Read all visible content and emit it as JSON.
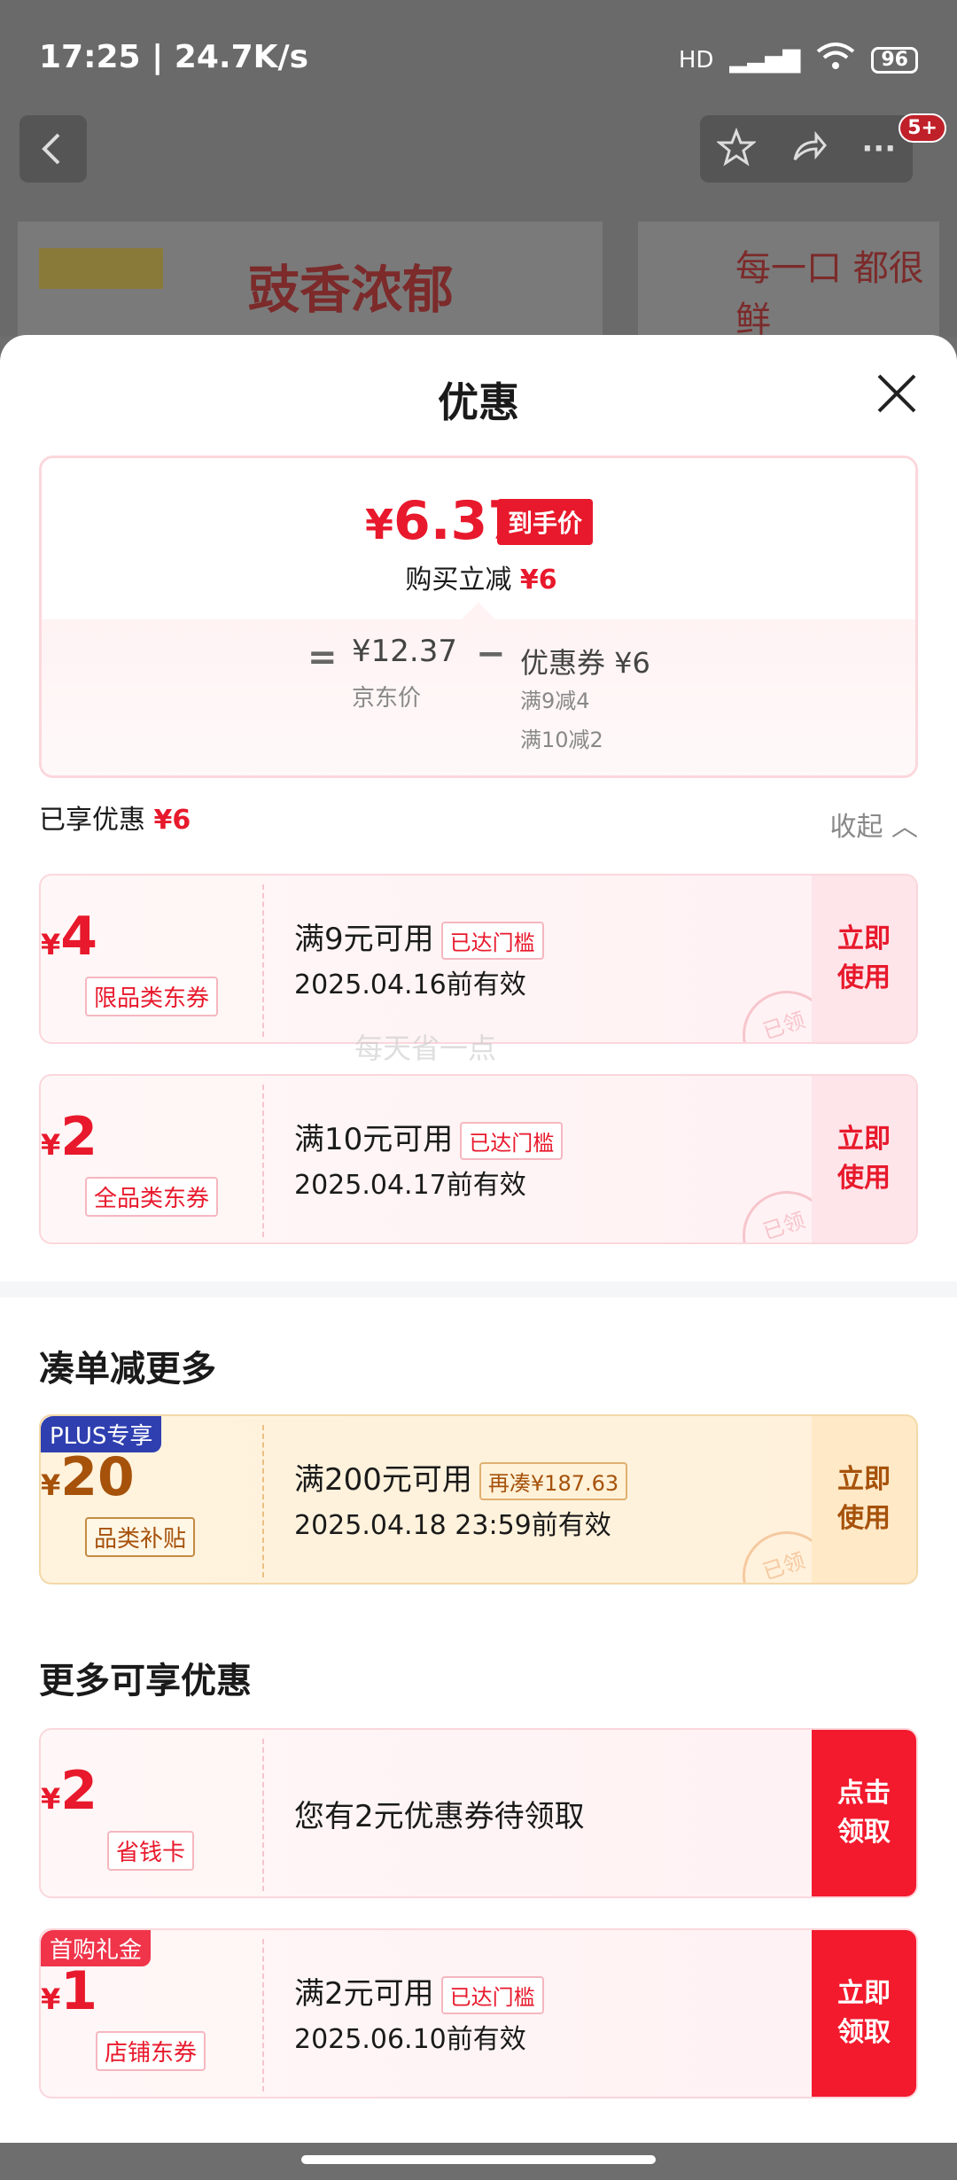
{
  "status_bar": {
    "time_speed": "17:25 | 24.7K/s",
    "network": "HD",
    "battery": "96"
  },
  "background": {
    "badge": "5+",
    "banner_text_1": "豉香浓郁",
    "banner_text_2": "每一口 都很鲜"
  },
  "sheet": {
    "title": "优惠",
    "price": {
      "yen": "¥",
      "final": "6.37",
      "final_tag": "到手价",
      "instant_label": "购买立减",
      "instant_value": "¥6",
      "eq": "=",
      "jd_price": "¥12.37",
      "jd_label": "京东价",
      "minus": "−",
      "coupon_sum": "优惠券 ¥6",
      "coupon_detail_1": "满9减4",
      "coupon_detail_2": "满10减2"
    },
    "enjoyed_label": "已享优惠",
    "enjoyed_value": "¥6",
    "collapse_label": "收起 ︿",
    "coupons": [
      {
        "yen": "¥",
        "amount": "4",
        "type": "限品类东券",
        "condition": "满9元可用",
        "tag": "已达门槛",
        "date": "2025.04.16前有效",
        "action_1": "立即",
        "action_2": "使用",
        "stamp": "已领"
      },
      {
        "yen": "¥",
        "amount": "2",
        "type": "全品类东券",
        "condition": "满10元可用",
        "tag": "已达门槛",
        "date": "2025.04.17前有效",
        "action_1": "立即",
        "action_2": "使用",
        "stamp": "已领"
      }
    ],
    "more_title": "凑单减更多",
    "plus_coupon": {
      "corner": "PLUS专享",
      "yen": "¥",
      "amount": "20",
      "type": "品类补贴",
      "condition": "满200元可用",
      "tag": "再凑¥187.63",
      "date": "2025.04.18 23:59前有效",
      "action_1": "立即",
      "action_2": "使用",
      "stamp": "已领"
    },
    "extra_title": "更多可享优惠",
    "saver_card": {
      "yen": "¥",
      "amount": "2",
      "type": "省钱卡",
      "message": "您有2元优惠券待领取",
      "action_1": "点击",
      "action_2": "领取"
    },
    "shop_coupon": {
      "corner": "首购礼金",
      "yen": "¥",
      "amount": "1",
      "type": "店铺东券",
      "condition": "满2元可用",
      "tag": "已达门槛",
      "date": "2025.06.10前有效",
      "action_1": "立即",
      "action_2": "领取"
    },
    "watermark": "每天省一点"
  },
  "colors": {
    "accent": "#e8192c",
    "gold": "#a6520b",
    "plus": "#2f3fb0"
  }
}
